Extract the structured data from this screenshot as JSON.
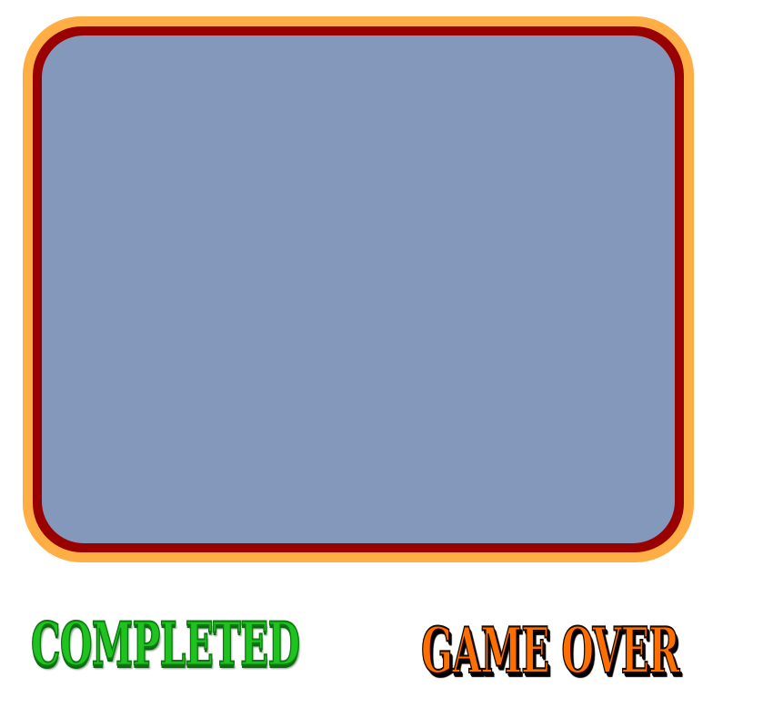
{
  "panel": {
    "outer_border_color": "#ffad45",
    "inner_border_color": "#990100",
    "fill_color": "#8398bb"
  },
  "labels": {
    "completed": "COMPLETED",
    "completed_color": "#1fc31f",
    "game_over": "GAME OVER",
    "game_over_color": "#ff6f00"
  }
}
